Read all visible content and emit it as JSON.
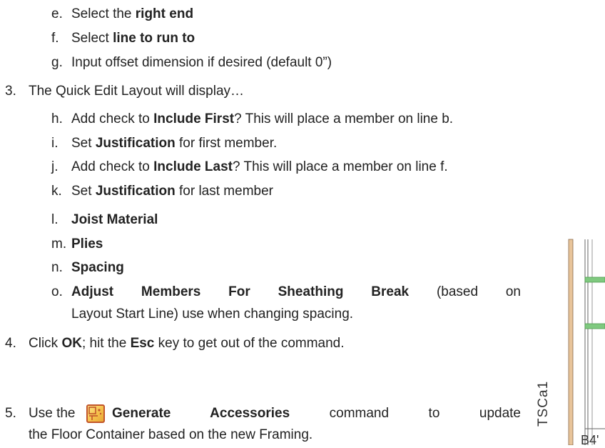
{
  "steps": {
    "e": {
      "marker": "e.",
      "pre": "Select the ",
      "bold": "right end",
      "post": ""
    },
    "f": {
      "marker": "f.",
      "pre": "Select ",
      "bold": "line to run to",
      "post": ""
    },
    "g": {
      "marker": "g.",
      "text": "Input offset dimension if desired (default 0”)"
    },
    "s3": {
      "marker": "3.",
      "text": "The Quick Edit Layout will display…"
    },
    "h": {
      "marker": "h.",
      "pre": "Add check to ",
      "bold": "Include First",
      "post": "? This will place a member on line b."
    },
    "i": {
      "marker": "i.",
      "pre": "Set ",
      "bold": "Justification",
      "post": " for first member."
    },
    "j": {
      "marker": "j.",
      "pre": "Add check to ",
      "bold": "Include Last",
      "post": "? This will place a member on line f."
    },
    "k": {
      "marker": "k.",
      "pre": "Set ",
      "bold": "Justification",
      "post": " for last member"
    },
    "l": {
      "marker": "l.",
      "bold": "Joist Material"
    },
    "m": {
      "marker": "m.",
      "bold": "Plies"
    },
    "n": {
      "marker": "n.",
      "bold": "Spacing"
    },
    "o": {
      "marker": "o.",
      "bold": "Adjust Members For Sheathing Break",
      "line1_post": " (based on",
      "line2": "Layout Start Line) use when changing spacing."
    },
    "s4": {
      "marker": "4.",
      "pre": "Click ",
      "bold1": "OK",
      "mid": "; hit the ",
      "bold2": "Esc",
      "post": " key to get out of the command."
    },
    "s5": {
      "marker": "5.",
      "pre": "Use the",
      "bold": "Generate Accessories",
      "line1_post": " command to update",
      "line2": "the Floor Container based on the new Framing."
    }
  },
  "drawing": {
    "label_vertical": "TSCa1",
    "label_partial": "B4'",
    "colors": {
      "stud": "#e8c49a",
      "bar": "#7fc97f",
      "line": "#666666"
    }
  },
  "icons": {
    "generate_accessories": "generate-accessories-icon"
  }
}
